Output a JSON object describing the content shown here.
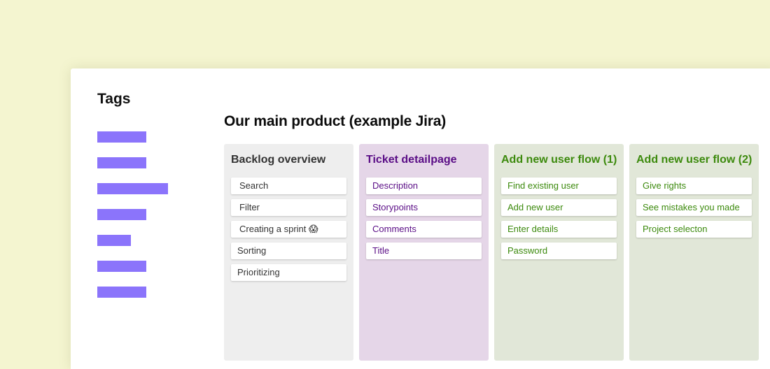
{
  "sidebar": {
    "title": "Tags",
    "tag_count": 7
  },
  "main": {
    "title": "Our main product (example Jira)",
    "columns": [
      {
        "title": "Backlog overview",
        "color": "#eeeeee",
        "cards": [
          "Search",
          "Filter",
          "Creating a sprint 😱",
          "Sorting",
          "Prioritizing"
        ]
      },
      {
        "title": "Ticket detailpage",
        "color": "#e5d6e8",
        "cards": [
          "Description",
          "Storypoints",
          "Comments",
          "Title"
        ]
      },
      {
        "title": "Add new user flow (1)",
        "color": "#e1e7d8",
        "cards": [
          "Find existing user",
          "Add new user",
          "Enter details",
          "Password"
        ]
      },
      {
        "title": "Add new user flow (2)",
        "color": "#e1e7d8",
        "cards": [
          "Give rights",
          "See mistakes you made",
          "Project selecton"
        ]
      }
    ]
  },
  "colors": {
    "background": "#f4f5d0",
    "tag_accent": "#8b74fb",
    "purple_text": "#5a0d86",
    "green_text": "#3c8a0d"
  }
}
